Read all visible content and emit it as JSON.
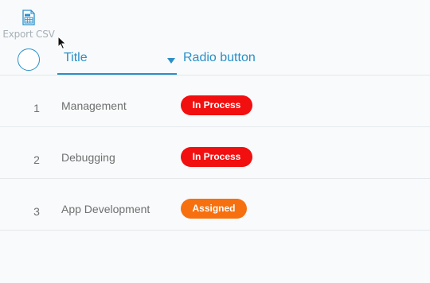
{
  "toolbar": {
    "export_label": "Export CSV",
    "export_icon": "csv-file-icon",
    "accent": "#2a8fc9"
  },
  "header": {
    "columns": [
      {
        "label": "Title",
        "sorted": "descending"
      },
      {
        "label": "Radio button"
      }
    ]
  },
  "rows": [
    {
      "number": "1",
      "title": "Management",
      "status": "In Process",
      "status_color": "#f20f0f"
    },
    {
      "number": "2",
      "title": "Debugging",
      "status": "In Process",
      "status_color": "#f20f0f"
    },
    {
      "number": "3",
      "title": "App Development",
      "status": "Assigned",
      "status_color": "#f7700f"
    }
  ]
}
